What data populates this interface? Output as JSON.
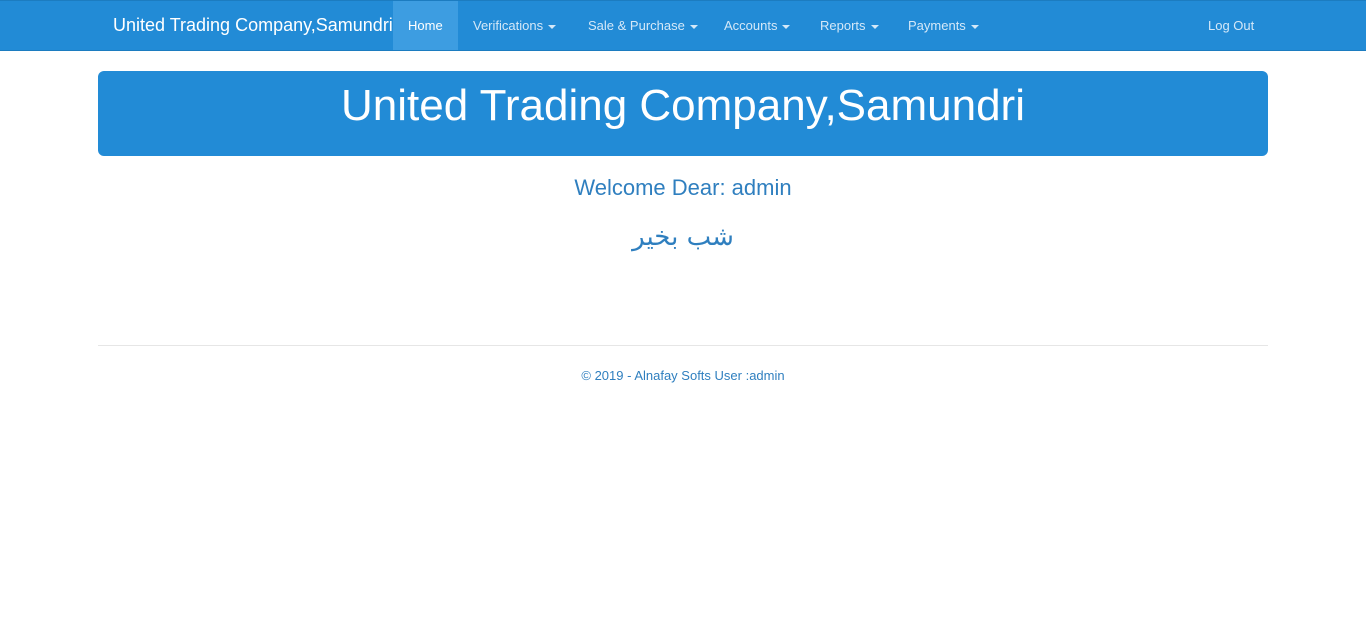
{
  "navbar": {
    "brand": "United Trading Company,Samundri",
    "items": [
      {
        "label": "Home"
      },
      {
        "label": "Verifications"
      },
      {
        "label": "Sale & Purchase"
      },
      {
        "label": "Accounts"
      },
      {
        "label": "Reports"
      },
      {
        "label": "Payments"
      }
    ],
    "logout": "Log Out"
  },
  "jumbotron": {
    "title": "United Trading Company,Samundri"
  },
  "main": {
    "welcome": "Welcome Dear: admin",
    "greeting": "شب بخیر"
  },
  "footer": {
    "text": "© 2019 - Alnafay Softs User :admin"
  },
  "colors": {
    "primary": "#228bd6",
    "active_nav": "#3d9de1",
    "text_blue": "#2f7fbf"
  }
}
